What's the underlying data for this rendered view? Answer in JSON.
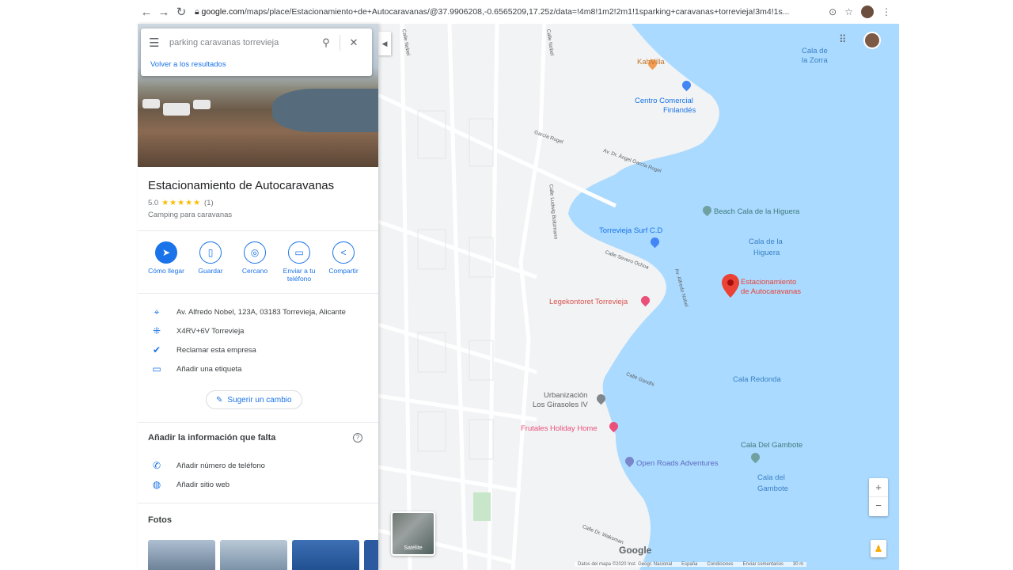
{
  "browser": {
    "url_domain": "google.com",
    "url_rest": "/maps/place/Estacionamiento+de+Autocaravanas/@37.9906208,-0.6565209,17.25z/data=!4m8!1m2!2m1!1sparking+caravanas+torrevieja!3m4!1s..."
  },
  "search": {
    "placeholder": "parking caravanas torrevieja",
    "back_link": "Volver a los resultados"
  },
  "place": {
    "title": "Estacionamiento de Autocaravanas",
    "rating": "5.0",
    "stars": "★★★★★",
    "reviews": "(1)",
    "category": "Camping para caravanas"
  },
  "actions": [
    {
      "label": "Cómo llegar",
      "icon": "directions-icon"
    },
    {
      "label": "Guardar",
      "icon": "bookmark-icon"
    },
    {
      "label": "Cercano",
      "icon": "nearby-icon"
    },
    {
      "label": "Enviar a tu teléfono",
      "icon": "send-to-phone-icon"
    },
    {
      "label": "Compartir",
      "icon": "share-icon"
    }
  ],
  "info": {
    "address": "Av. Alfredo Nobel, 123A, 03183 Torrevieja, Alicante",
    "pluscode": "X4RV+6V Torrevieja",
    "claim": "Reclamar esta empresa",
    "label": "Añadir una etiqueta"
  },
  "suggest_label": "Sugerir un cambio",
  "missing": {
    "title": "Añadir la información que falta",
    "phone": "Añadir número de teléfono",
    "web": "Añadir sitio web"
  },
  "photos_title": "Fotos",
  "map": {
    "places": {
      "kahvilla": "KahVilla",
      "centro_line1": "Centro Comercial",
      "centro_line2": "Finlandés",
      "beach": "Beach Cala de la Higuera",
      "surf": "Torrevieja Surf C.D",
      "legekontoret": "Legekontoret Torrevieja",
      "marker_line1": "Estacionamiento",
      "marker_line2": "de Autocaravanas",
      "urb_line1": "Urbanización",
      "urb_line2": "Los Girasoles IV",
      "frutales": "Frutales Holiday Home",
      "open_roads": "Open Roads Adventures",
      "cala_gambote_poi": "Cala Del Gambote"
    },
    "water": {
      "zorra_line1": "Cala de",
      "zorra_line2": "la Zorra",
      "higuera_line1": "Cala de la",
      "higuera_line2": "Higuera",
      "redonda": "Cala Redonda",
      "gambote_line1": "Cala del",
      "gambote_line2": "Gambote"
    },
    "streets": {
      "s1": "Calle Nobel",
      "s2": "Calle Nobel",
      "s3": "Av. Dr. Ángel García Rogel",
      "s4": "Calle Severo Ochoa",
      "s5": "Av. Alfredo Nobel",
      "s6": "Calle Gandhi",
      "s7": "Calle Dr. Waksman",
      "s8": "Calle Ludwig Boltzmann",
      "s9": "García Rogel"
    },
    "satellite_label": "Satélite",
    "google": "Google",
    "footer": [
      "Datos del mapa ©2020 Inst. Geogr. Nacional",
      "España",
      "Condiciones",
      "Enviar comentarios",
      "30 m"
    ]
  },
  "colors": {
    "accent": "#1a73e8",
    "marker": "#ea4335",
    "water": "#aadaff",
    "star": "#fbbc04"
  }
}
